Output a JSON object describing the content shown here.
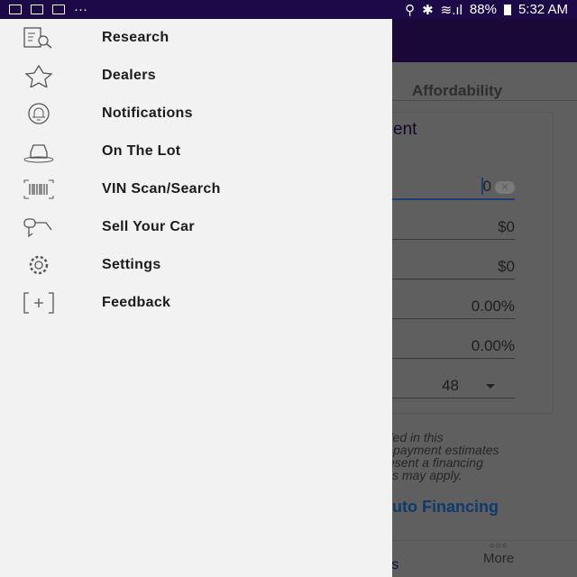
{
  "status_bar": {
    "battery": "88%",
    "time": "5:32 AM",
    "overflow": "···"
  },
  "background": {
    "tab": "Affordability",
    "card_heading_fragment": "ent",
    "fields": [
      {
        "value": "0",
        "active": true
      },
      {
        "value": "$0"
      },
      {
        "value": "$0"
      },
      {
        "value": "0.00%"
      },
      {
        "value": "0.00%"
      },
      {
        "value": "48"
      }
    ],
    "disclaimer_fragments": [
      "uded in this",
      "payment estimates",
      "esent a financing",
      "s may apply."
    ],
    "link_fragment": "uto Financing",
    "nav_fragment": "ors",
    "more_label": "More"
  },
  "drawer": {
    "items": [
      {
        "label": "Research",
        "icon": "research-icon"
      },
      {
        "label": "Dealers",
        "icon": "star-icon"
      },
      {
        "label": "Notifications",
        "icon": "bell-icon"
      },
      {
        "label": "On The Lot",
        "icon": "car-lot-icon"
      },
      {
        "label": "VIN Scan/Search",
        "icon": "barcode-icon"
      },
      {
        "label": "Sell Your Car",
        "icon": "key-icon"
      },
      {
        "label": "Settings",
        "icon": "gear-icon"
      },
      {
        "label": "Feedback",
        "icon": "feedback-icon"
      }
    ]
  }
}
